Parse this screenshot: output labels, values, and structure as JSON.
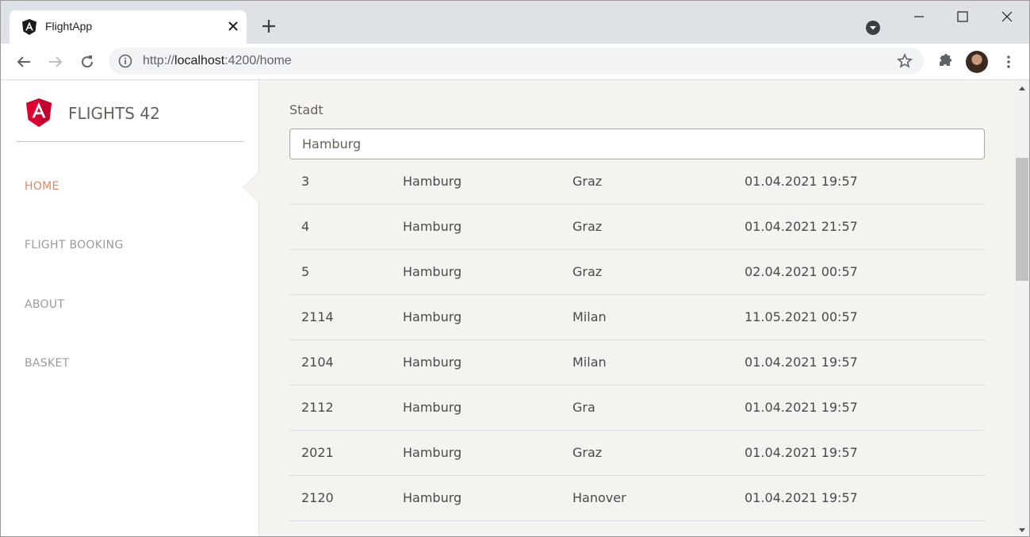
{
  "browser": {
    "tab_title": "FlightApp",
    "url_scheme": "http://",
    "url_host": "localhost",
    "url_path": ":4200/home"
  },
  "app": {
    "brand": "FLIGHTS 42",
    "nav": [
      {
        "label": "HOME",
        "active": true
      },
      {
        "label": "FLIGHT BOOKING",
        "active": false
      },
      {
        "label": "ABOUT",
        "active": false
      },
      {
        "label": "BASKET",
        "active": false
      }
    ],
    "accent_color": "#ef8157"
  },
  "search": {
    "label": "Stadt",
    "value": "Hamburg"
  },
  "flights": [
    {
      "id": "3",
      "from": "Hamburg",
      "to": "Graz",
      "date": "01.04.2021 19:57"
    },
    {
      "id": "4",
      "from": "Hamburg",
      "to": "Graz",
      "date": "01.04.2021 21:57"
    },
    {
      "id": "5",
      "from": "Hamburg",
      "to": "Graz",
      "date": "02.04.2021 00:57"
    },
    {
      "id": "2114",
      "from": "Hamburg",
      "to": "Milan",
      "date": "11.05.2021 00:57"
    },
    {
      "id": "2104",
      "from": "Hamburg",
      "to": "Milan",
      "date": "01.04.2021 19:57"
    },
    {
      "id": "2112",
      "from": "Hamburg",
      "to": "Gra",
      "date": "01.04.2021 19:57"
    },
    {
      "id": "2021",
      "from": "Hamburg",
      "to": "Graz",
      "date": "01.04.2021 19:57"
    },
    {
      "id": "2120",
      "from": "Hamburg",
      "to": "Hanover",
      "date": "01.04.2021 19:57"
    }
  ]
}
